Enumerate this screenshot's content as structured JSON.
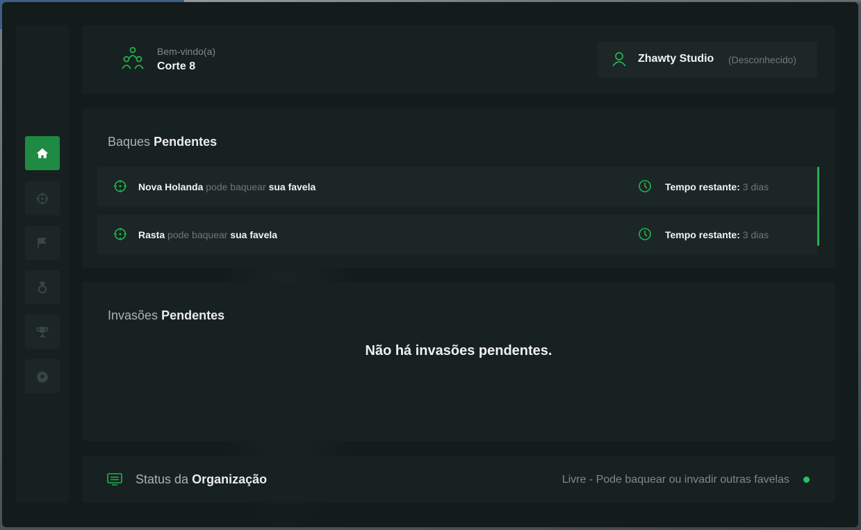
{
  "colors": {
    "accent": "#22b34e",
    "accent_dark": "#1f8a43",
    "panel": "#172121",
    "window": "#131b1b"
  },
  "sidebar": {
    "items": [
      {
        "icon": "home-icon",
        "active": true
      },
      {
        "icon": "crosshair-icon",
        "active": false
      },
      {
        "icon": "flag-icon",
        "active": false
      },
      {
        "icon": "medal-icon",
        "active": false
      },
      {
        "icon": "trophy-icon",
        "active": false
      },
      {
        "icon": "gear-icon",
        "active": false
      }
    ]
  },
  "header": {
    "welcome_label": "Bem-vindo(a)",
    "org_name": "Corte 8",
    "user_name": "Zhawty Studio",
    "user_status": "(Desconhecido)"
  },
  "baques": {
    "title_prefix": "Baques",
    "title_bold": "Pendentes",
    "rows": [
      {
        "name": "Nova Holanda",
        "verb": "pode baquear",
        "target": "sua favela",
        "time_label": "Tempo restante:",
        "time_value": "3 dias"
      },
      {
        "name": "Rasta",
        "verb": "pode baquear",
        "target": "sua favela",
        "time_label": "Tempo restante:",
        "time_value": "3 dias"
      }
    ]
  },
  "invasoes": {
    "title_prefix": "Invasões",
    "title_bold": "Pendentes",
    "empty_message": "Não há invasões pendentes."
  },
  "status": {
    "title_prefix": "Status da",
    "title_bold": "Organização",
    "text": "Livre - Pode baquear ou invadir outras favelas"
  }
}
